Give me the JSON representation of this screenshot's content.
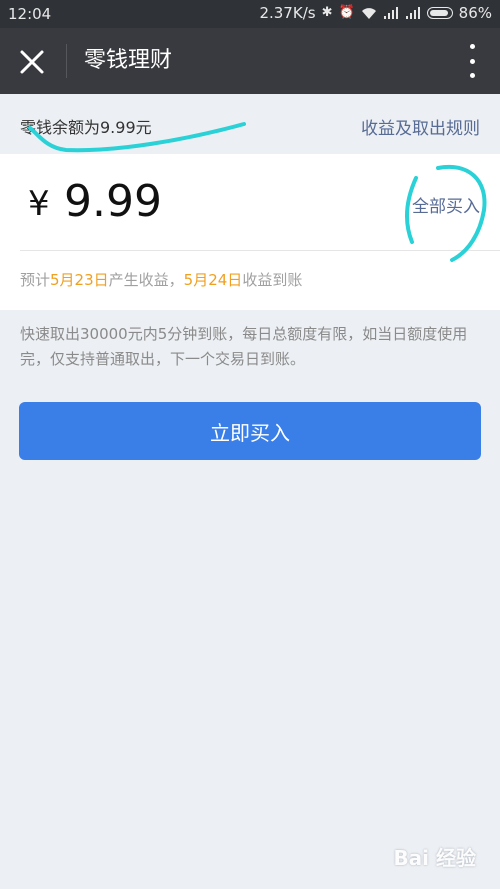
{
  "status_bar": {
    "time": "12:04",
    "speed": "2.37K/s",
    "battery": "86%"
  },
  "nav": {
    "title": "零钱理财",
    "close_icon": "close-icon",
    "more_icon": "more-vertical-icon"
  },
  "balance": {
    "text": "零钱余额为9.99元",
    "rules_link": "收益及取出规则"
  },
  "amount": {
    "currency": "¥",
    "value": "9.99",
    "buy_all": "全部买入"
  },
  "forecast": {
    "prefix": "预计",
    "date1": "5月23日",
    "middle": "产生收益，",
    "date2": "5月24日",
    "suffix": "收益到账"
  },
  "notice": "快速取出30000元内5分钟到账，每日总额度有限，如当日额度使用完，仅支持普通取出，下一个交易日到账。",
  "buy_button": "立即买入",
  "watermark": "Bai 经验",
  "colors": {
    "nav_bg": "#393a3f",
    "link": "#576b95",
    "highlight": "#f0a020",
    "button": "#3a7ee8",
    "annotation": "#2ad1d6"
  }
}
